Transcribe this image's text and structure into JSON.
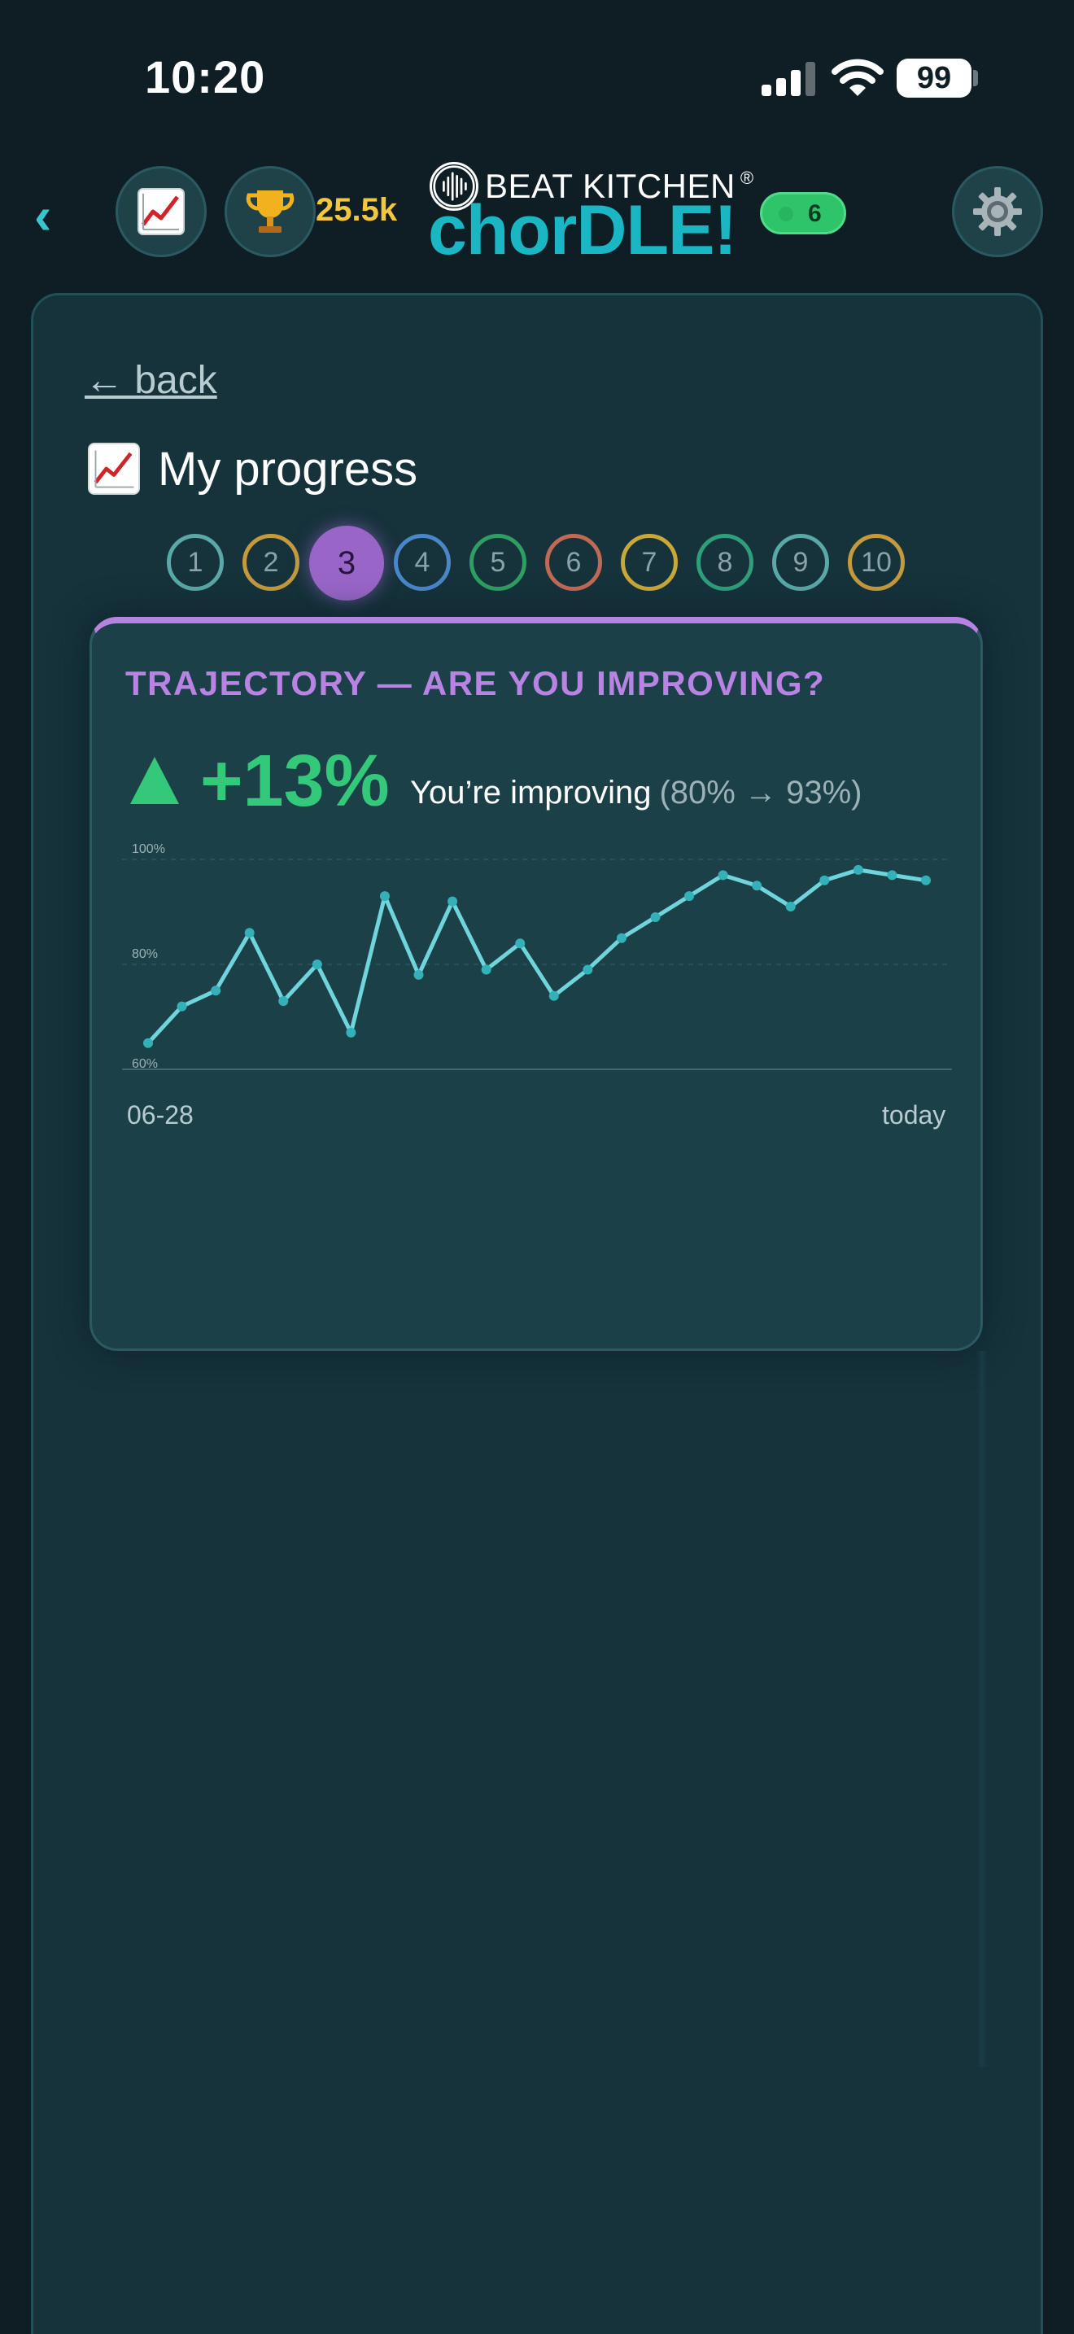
{
  "status_bar": {
    "time": "10:20",
    "battery": "99",
    "icons": [
      "signal-icon",
      "wifi-icon",
      "battery-icon"
    ]
  },
  "header": {
    "back_icon": "chevron-left-icon",
    "progress_button_icon": "chart-increasing-icon",
    "trophy_icon": "trophy-icon",
    "trophy_score": "25.5k",
    "brand": {
      "top_line": "BEAT KITCHEN",
      "registered_mark": "®",
      "main": "chorDLE!",
      "accent_color": "#1bb6c4"
    },
    "streak_count": "6",
    "settings_icon": "gear-icon"
  },
  "page": {
    "back_link": "← back",
    "title_icon": "chart-increasing-icon",
    "title": "My progress",
    "levels": [
      "1",
      "2",
      "3",
      "4",
      "5",
      "6",
      "7",
      "8",
      "9",
      "10"
    ],
    "selected_level": "3",
    "level_colors": [
      "#5aa8a8",
      "#c49a3d",
      "#9966c8",
      "#4a86c8",
      "#2f9e62",
      "#c06a55",
      "#c8a838",
      "#2f9e7a",
      "#5aa8a8",
      "#c49a3d"
    ]
  },
  "trajectory": {
    "heading": "TRAJECTORY — ARE YOU IMPROVING?",
    "change": "+13%",
    "status": "You’re improving",
    "range": "(80% → 93%)",
    "color_up": "#34c97a"
  },
  "chart_data": {
    "type": "line",
    "ylim": [
      60,
      100
    ],
    "yticks": [
      "100%",
      "80%",
      "60%"
    ],
    "ytick_values": [
      100,
      80,
      60
    ],
    "x_start_label": "06-28",
    "x_end_label": "today",
    "grid": true,
    "line_color": "#6fd4dc",
    "point_color": "#34b0b8",
    "values": [
      65,
      72,
      75,
      86,
      73,
      80,
      67,
      93,
      78,
      92,
      79,
      84,
      74,
      79,
      85,
      89,
      93,
      97,
      95,
      91,
      96,
      98,
      97,
      96
    ]
  }
}
